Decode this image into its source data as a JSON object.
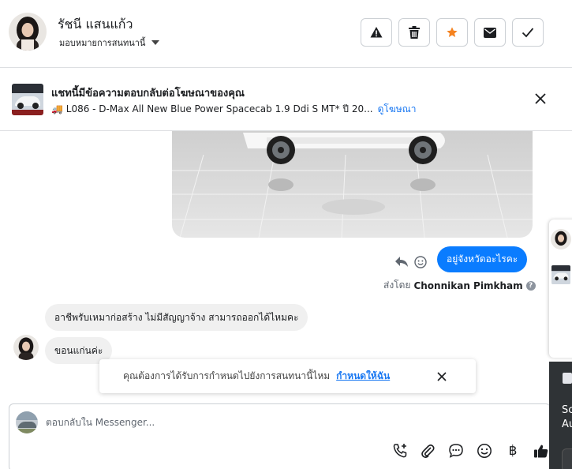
{
  "header": {
    "contact_name": "รัชนี แสนแก้ว",
    "assign_label": "มอบหมายการสนทนานี้",
    "actions": [
      "report",
      "delete",
      "star",
      "mark-unread",
      "done"
    ],
    "star_color": "#f5821f"
  },
  "ad_banner": {
    "title": "แชทนี้มีข้อความตอบกลับต่อโฆษณาของคุณ",
    "ad_text": "🚚 L086 - D-Max All New Blue Power Spacecab 1.9 Ddi S MT* ปี 20...",
    "ad_link": "ดูโฆษณา"
  },
  "messages": {
    "outgoing_1": "อยู่จังหวัดอะไรคะ",
    "sent_by_prefix": "ส่งโดย",
    "sent_by_name": "Chonnikan Pimkham",
    "incoming_1": "อาชีพรับเหมาก่อสร้าง ไม่มีสัญญาจ้าง สามารถออกได้ไหมคะ",
    "incoming_2": "ขอนแก่นค่ะ"
  },
  "toast": {
    "text": "คุณต้องการได้รับการกำหนดไปยังการสนทนานี้ไหม",
    "link": "กำหนดให้ฉัน"
  },
  "composer": {
    "placeholder": "ตอบกลับใน Messenger...",
    "tools": [
      "call-plus-icon",
      "paperclip-icon",
      "quick-reply-icon",
      "emoji-icon",
      "baht-icon",
      "thumbs-up-icon"
    ],
    "baht_symbol": "฿"
  },
  "side_panel": {
    "text_1": "Sc",
    "text_2": "Au"
  },
  "colors": {
    "accent": "#0a7cff",
    "link": "#1877f2"
  }
}
